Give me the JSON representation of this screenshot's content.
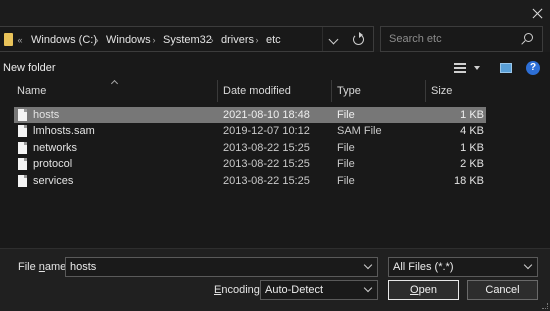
{
  "address_bar": {
    "breadcrumbs": [
      "Windows (C:)",
      "Windows",
      "System32",
      "drivers",
      "etc"
    ],
    "overflow_glyph": "«",
    "separator_glyph": "›"
  },
  "search": {
    "placeholder": "Search etc"
  },
  "toolbar": {
    "new_folder": "New folder",
    "help_glyph": "?"
  },
  "columns": {
    "name": "Name",
    "date": "Date modified",
    "type": "Type",
    "size": "Size"
  },
  "files": [
    {
      "name": "hosts",
      "date": "2021-08-10 18:48",
      "type": "File",
      "size": "1 KB",
      "selected": true
    },
    {
      "name": "lmhosts.sam",
      "date": "2019-12-07 10:12",
      "type": "SAM File",
      "size": "4 KB",
      "selected": false
    },
    {
      "name": "networks",
      "date": "2013-08-22 15:25",
      "type": "File",
      "size": "1 KB",
      "selected": false
    },
    {
      "name": "protocol",
      "date": "2013-08-22 15:25",
      "type": "File",
      "size": "2 KB",
      "selected": false
    },
    {
      "name": "services",
      "date": "2013-08-22 15:25",
      "type": "File",
      "size": "18 KB",
      "selected": false
    }
  ],
  "footer": {
    "file_name_label_prefix": "File ",
    "file_name_label_access": "n",
    "file_name_label_suffix": "ame:",
    "file_name_value": "hosts",
    "file_type_value": "All Files  (*.*)",
    "encoding_label_access": "E",
    "encoding_label_suffix": "ncoding:",
    "encoding_value": "Auto-Detect",
    "open_access": "O",
    "open_suffix": "pen",
    "cancel": "Cancel"
  },
  "colors": {
    "selection": "#777777",
    "background": "#191919",
    "panel": "#202020",
    "folder": "#e9c35a",
    "help": "#2d6fd6"
  },
  "icons": [
    "folder-icon",
    "close-icon",
    "chevron-down-icon",
    "refresh-icon",
    "search-icon",
    "view-options-icon",
    "preview-pane-icon",
    "help-icon",
    "file-icon"
  ]
}
